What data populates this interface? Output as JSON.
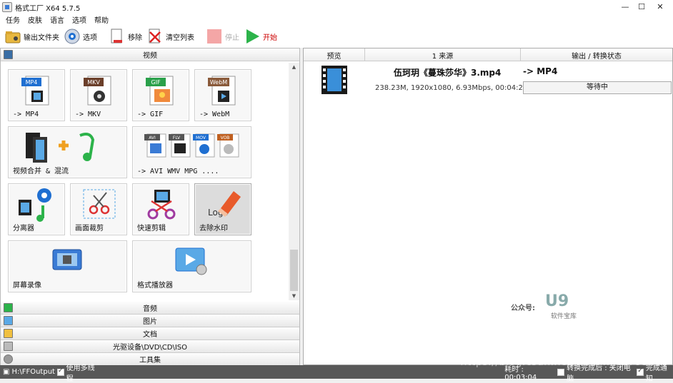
{
  "window": {
    "title": "格式工厂 X64 5.7.5",
    "minimize": "—",
    "maximize": "☐",
    "close": "✕"
  },
  "menu": [
    "任务",
    "皮肤",
    "语言",
    "选项",
    "帮助"
  ],
  "toolbar": {
    "output_folder": "输出文件夹",
    "options": "选项",
    "remove": "移除",
    "clear_list": "清空列表",
    "stop": "停止",
    "start": "开始"
  },
  "left": {
    "video_header": "视频",
    "tiles": [
      {
        "label": "-> MP4",
        "badge": "MP4"
      },
      {
        "label": "-> MKV",
        "badge": "MKV"
      },
      {
        "label": "-> GIF",
        "badge": "GIF"
      },
      {
        "label": "-> WebM",
        "badge": "WebM"
      },
      {
        "label": "视频合并 & 混流"
      },
      {
        "label": "-> AVI WMV MPG ....",
        "badges": [
          "AVI",
          "FLV",
          "MOV",
          "VOB"
        ]
      },
      {
        "label": "分离器"
      },
      {
        "label": "画面裁剪"
      },
      {
        "label": "快速剪辑"
      },
      {
        "label": "去除水印",
        "logo_text": "Logo"
      },
      {
        "label": "屏幕录像"
      },
      {
        "label": "格式播放器"
      }
    ],
    "categories": [
      "音频",
      "图片",
      "文档",
      "光驱设备\\DVD\\CD\\ISO",
      "工具集"
    ]
  },
  "table": {
    "headers": [
      "预览",
      "1 来源",
      "输出 / 转换状态"
    ],
    "row": {
      "name": "伍珂玥《蔓珠莎华》3.mp4",
      "info": "238.23M, 1920x1080, 6.93Mbps, 00:04:23",
      "output": "-> MP4",
      "status": "等待中"
    }
  },
  "watermark": {
    "label": "公众号:",
    "logo": "U9",
    "sub": "软件宝库"
  },
  "statusbar": {
    "path": "H:\\FFOutput",
    "multithread": "使用多线程",
    "elapsed": "耗时 : 00:03:04",
    "after_done": "转换完成后 : 关闭电脑",
    "notify": "完成通知"
  },
  "overlay": "https://blog.csdn.net/weixin_42793435",
  "colors": {
    "accent_blue": "#1f6fd1",
    "start_green": "#2cb34a",
    "stop_red": "#f4a6a6",
    "status_bg": "#585858"
  }
}
